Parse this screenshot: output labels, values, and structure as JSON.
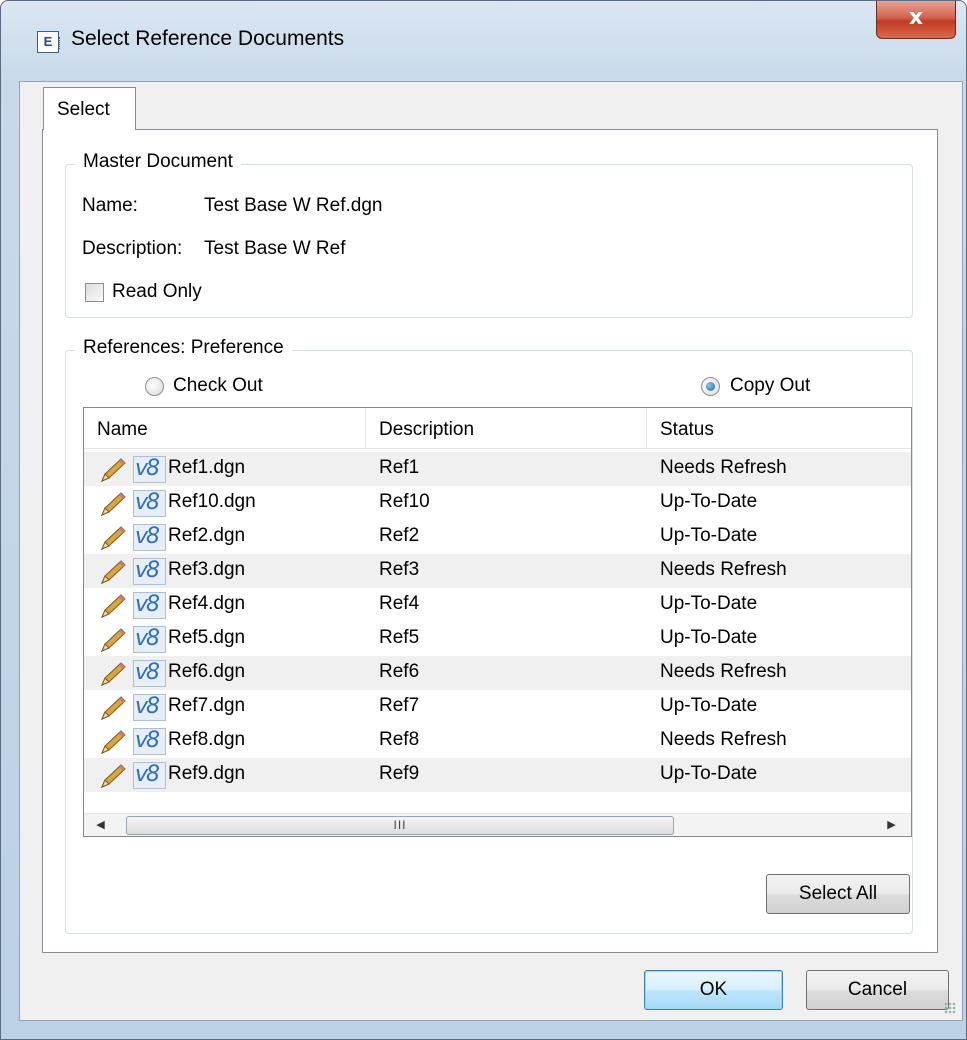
{
  "window": {
    "title": "Select Reference Documents",
    "close_glyph": "x"
  },
  "tabs": [
    {
      "label": "Select"
    }
  ],
  "master_document": {
    "legend": "Master Document",
    "name_label": "Name:",
    "name_value": "Test Base W Ref.dgn",
    "description_label": "Description:",
    "description_value": "Test Base W Ref",
    "read_only_label": "Read Only",
    "read_only_checked": false
  },
  "references": {
    "legend": "References: Preference",
    "check_out_label": "Check Out",
    "copy_out_label": "Copy Out",
    "selected_option": "Copy Out",
    "columns": [
      "Name",
      "Description",
      "Status"
    ],
    "rows": [
      {
        "name": "Ref1.dgn",
        "description": "Ref1",
        "status": "Needs Refresh"
      },
      {
        "name": "Ref10.dgn",
        "description": "Ref10",
        "status": "Up-To-Date"
      },
      {
        "name": "Ref2.dgn",
        "description": "Ref2",
        "status": "Up-To-Date"
      },
      {
        "name": "Ref3.dgn",
        "description": "Ref3",
        "status": "Needs Refresh"
      },
      {
        "name": "Ref4.dgn",
        "description": "Ref4",
        "status": "Up-To-Date"
      },
      {
        "name": "Ref5.dgn",
        "description": "Ref5",
        "status": "Up-To-Date"
      },
      {
        "name": "Ref6.dgn",
        "description": "Ref6",
        "status": "Needs Refresh"
      },
      {
        "name": "Ref7.dgn",
        "description": "Ref7",
        "status": "Up-To-Date"
      },
      {
        "name": "Ref8.dgn",
        "description": "Ref8",
        "status": "Needs Refresh"
      },
      {
        "name": "Ref9.dgn",
        "description": "Ref9",
        "status": "Up-To-Date"
      }
    ],
    "file_icon_text": "v8",
    "scroll_thumb_glyph": "III",
    "select_all_label": "Select All"
  },
  "footer": {
    "ok_label": "OK",
    "cancel_label": "Cancel"
  },
  "colors": {
    "title_gradient": "#c9d9ea",
    "close_button": "#c13b22",
    "default_button_border": "#3c7fb1",
    "alt_row": "#f0f0f0"
  },
  "icons": {
    "app": "document-icon",
    "close": "close-icon",
    "row_edit": "pencil-icon",
    "row_file": "v8-file-icon",
    "scroll_left": "arrow-left-icon",
    "scroll_right": "arrow-right-icon"
  }
}
